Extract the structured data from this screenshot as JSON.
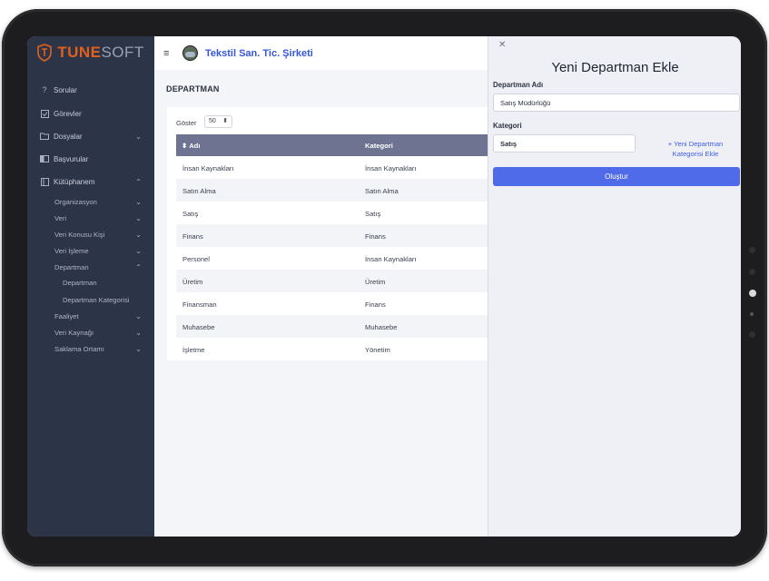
{
  "logo": {
    "brand_main": "TUNE",
    "brand_soft": "SOFT"
  },
  "sidebar": {
    "items": [
      {
        "label": "Sorular",
        "icon": "question-icon"
      },
      {
        "label": "Görevler",
        "icon": "checklist-icon"
      },
      {
        "label": "Dosyalar",
        "icon": "folder-icon"
      },
      {
        "label": "Başvurular",
        "icon": "book-open-icon"
      },
      {
        "label": "Kütüphanem",
        "icon": "book-icon"
      }
    ],
    "sub_items": [
      "Organizasyon",
      "Veri",
      "Veri Konusu Kişi",
      "Veri İşleme",
      "Departman"
    ],
    "department_children": [
      "Departman",
      "Departman Kategorisi"
    ],
    "after_items": [
      "Faaliyet",
      "Veri Kaynağı",
      "Saklama Ortamı"
    ]
  },
  "topbar": {
    "company_name": "Tekstil San. Tic. Şirketi"
  },
  "page": {
    "title": "DEPARTMAN",
    "show_label": "Göster",
    "show_value": "50",
    "columns": [
      "Adı",
      "Kategori"
    ],
    "rows": [
      [
        "İnsan Kaynakları",
        "İnsan Kaynakları"
      ],
      [
        "Satın Alma",
        "Satın Alma"
      ],
      [
        "Satış",
        "Satış"
      ],
      [
        "Finans",
        "Finans"
      ],
      [
        "Personel",
        "İnsan Kaynakları"
      ],
      [
        "Üretim",
        "Üretim"
      ],
      [
        "Finansman",
        "Finans"
      ],
      [
        "Muhasebe",
        "Muhasebe"
      ],
      [
        "İşletme",
        "Yönetim"
      ]
    ]
  },
  "panel": {
    "title": "Yeni Departman Ekle",
    "name_label": "Departman Adı",
    "name_value": "Satış Müdürlüğü",
    "category_label": "Kategori",
    "category_value": "Satış",
    "add_category_line1": "+ Yeni Departman",
    "add_category_line2": "Kategorisi Ekle",
    "create_label": "Oluştur"
  },
  "colors": {
    "sidebar_bg": "#2c3447",
    "brand_orange": "#e0601e",
    "accent_blue": "#4f6bea",
    "table_header": "#6d7390"
  }
}
